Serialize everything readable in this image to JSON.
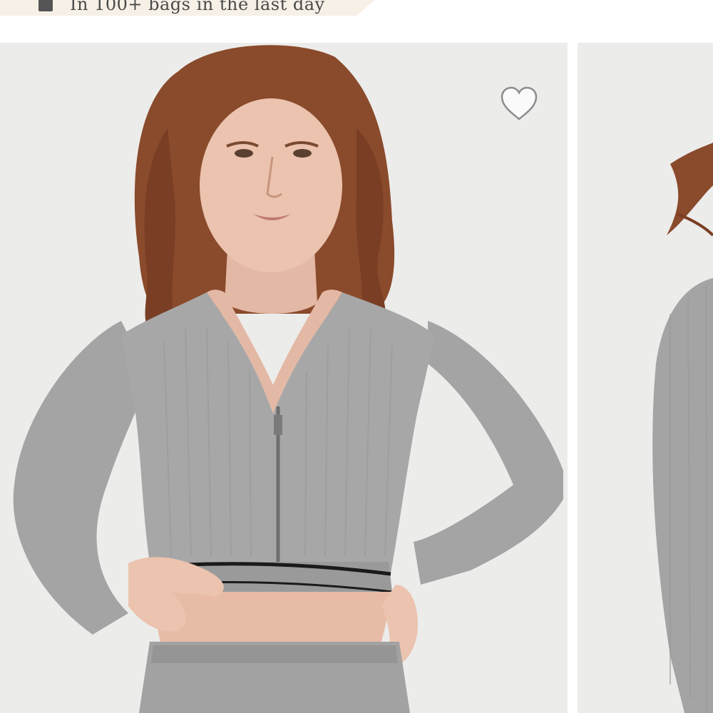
{
  "banner": {
    "text": "In 100+ bags in the last day",
    "icon": "bag-icon",
    "background": "#f6f0e6"
  },
  "gallery": {
    "images": [
      {
        "icon": "product-photo",
        "description_alt": "Model wearing grey cable-knit cropped zip cardigan"
      },
      {
        "icon": "product-photo"
      }
    ],
    "wishlist_icon": "heart-outline-icon"
  },
  "colors": {
    "photo_background": "#ececea",
    "garment": "#a4a4a4",
    "trim": "#1a1a1a"
  }
}
